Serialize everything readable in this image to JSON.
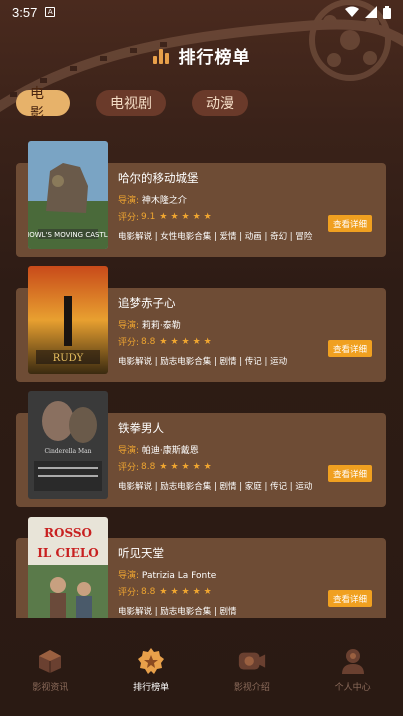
{
  "status": {
    "time": "3:57",
    "notice": "A"
  },
  "header": {
    "title": "排行榜单",
    "icon": "bar-chart-icon"
  },
  "tabs": [
    {
      "label": "电影",
      "active": true
    },
    {
      "label": "电视剧",
      "active": false
    },
    {
      "label": "动漫",
      "active": false
    }
  ],
  "labels": {
    "director": "导演:",
    "rating": "评分:",
    "detail_button": "查看详细"
  },
  "movies": [
    {
      "title": "哈尔的移动城堡",
      "director": "神木隆之介",
      "rating": "9.1",
      "stars": 5,
      "tags": "电影解说 | 女性电影合集 | 爱情 | 动画 | 奇幻 | 冒险",
      "poster_label": "HOWL'S MOVING CASTLE"
    },
    {
      "title": "追梦赤子心",
      "director": "莉莉·泰勒",
      "rating": "8.8",
      "stars": 5,
      "tags": "电影解说 | 励志电影合集 | 剧情 | 传记 | 运动",
      "poster_label": "RUDY"
    },
    {
      "title": "铁拳男人",
      "director": "帕迪·康斯戴恩",
      "rating": "8.8",
      "stars": 5,
      "tags": "电影解说 | 励志电影合集 | 剧情 | 家庭 | 传记 | 运动",
      "poster_label": "Cinderella Man"
    },
    {
      "title": "听见天堂",
      "director": "Patrizia La Fonte",
      "rating": "8.8",
      "stars": 5,
      "tags": "电影解说 | 励志电影合集 | 剧情",
      "poster_label": "ROSSO come IL CIELO"
    }
  ],
  "nav": [
    {
      "label": "影视资讯",
      "icon": "box-icon",
      "active": false
    },
    {
      "label": "排行榜单",
      "icon": "ranking-badge-icon",
      "active": true
    },
    {
      "label": "影视介绍",
      "icon": "film-camera-icon",
      "active": false
    },
    {
      "label": "个人中心",
      "icon": "user-icon",
      "active": false
    }
  ],
  "colors": {
    "accent": "#f0a630",
    "active_tab": "#e7b26a",
    "card": "#6e4c35",
    "button": "#f0a020"
  }
}
